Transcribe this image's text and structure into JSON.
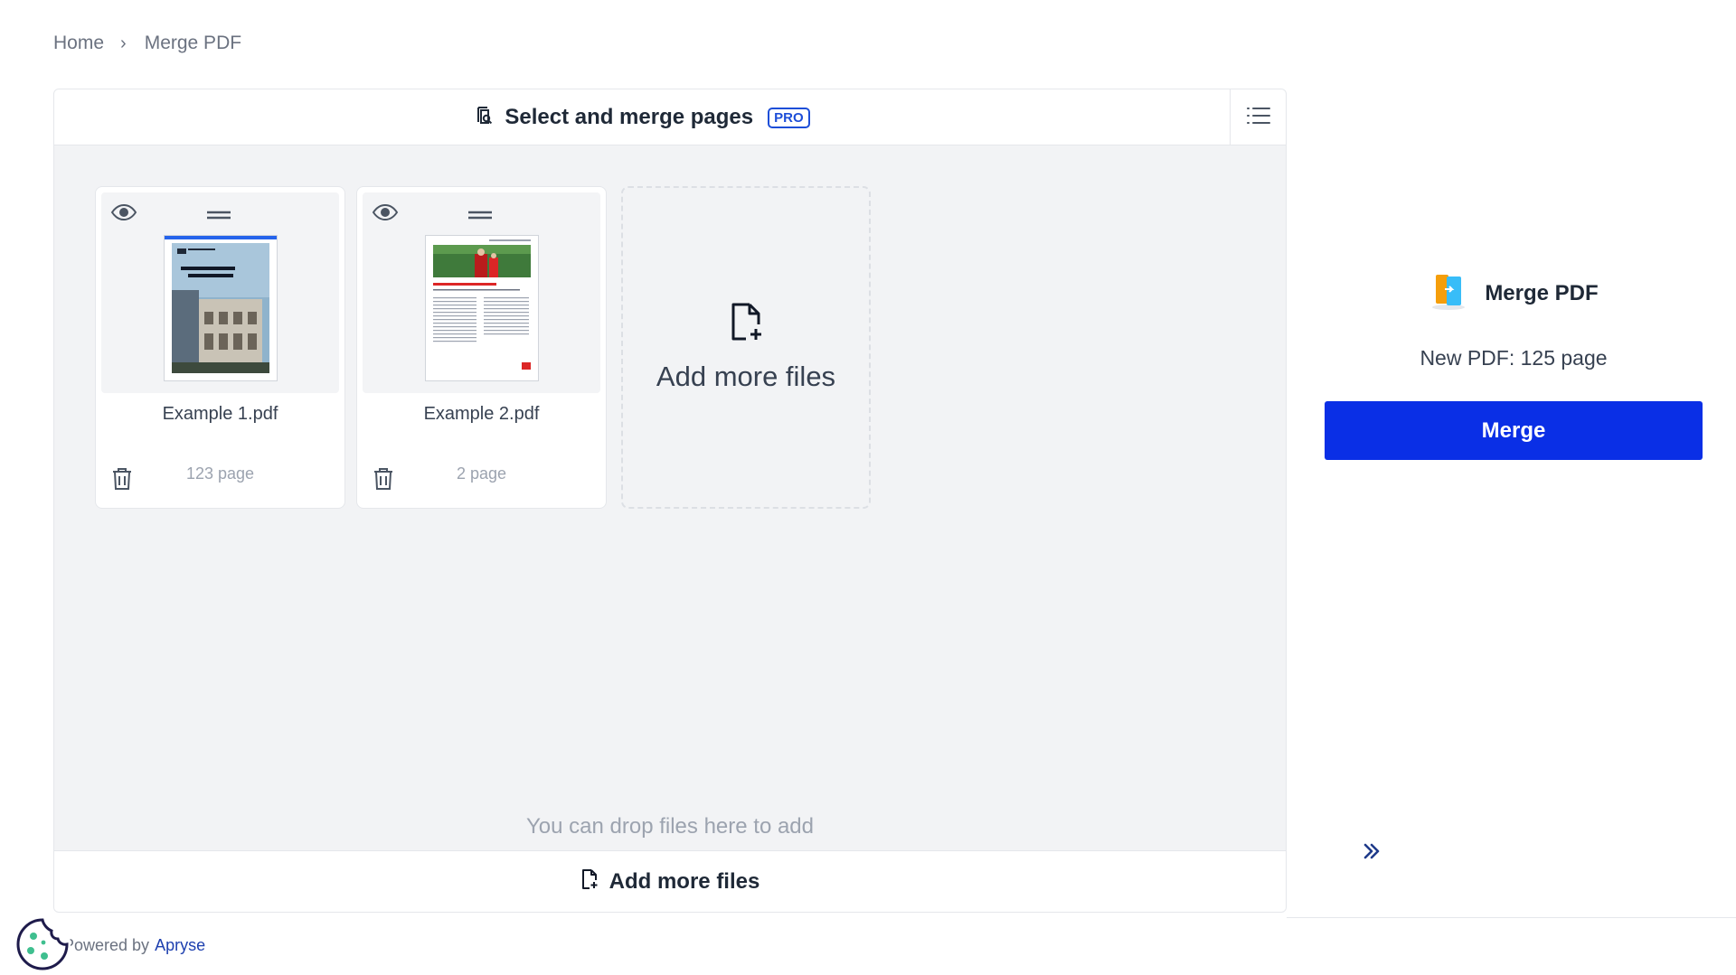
{
  "breadcrumb": {
    "home": "Home",
    "separator": "›",
    "current": "Merge PDF"
  },
  "workspace": {
    "title": "Select and merge pages",
    "badge": "PRO",
    "files": [
      {
        "name": "Example 1.pdf",
        "pages": "123 page",
        "thumb_title": "ANNUAL REPORT"
      },
      {
        "name": "Example 2.pdf",
        "pages": "2 page",
        "thumb_title": "Healthcare spending account"
      }
    ],
    "add_card_label": "Add more files",
    "drop_hint": "You can drop files here to add",
    "footer_label": "Add more files"
  },
  "sidebar": {
    "title": "Merge PDF",
    "summary": "New PDF: 125 page",
    "merge_label": "Merge"
  },
  "footer": {
    "powered_prefix": "Powered by",
    "brand": "Apryse"
  },
  "colors": {
    "accent": "#0a2fe6",
    "badge": "#1d4ed8",
    "cookie": "#3fbf8f"
  }
}
